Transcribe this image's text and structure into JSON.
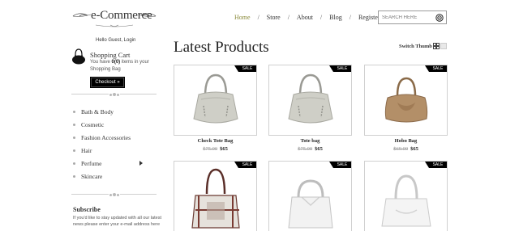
{
  "header": {
    "logo_text": "e-Commerce",
    "nav": [
      {
        "label": "Home"
      },
      {
        "label": "Store"
      },
      {
        "label": "About"
      },
      {
        "label": "Blog"
      },
      {
        "label": "Register"
      }
    ],
    "nav_separator": "/",
    "search": {
      "placeholder": "SEARCH HERE"
    }
  },
  "sidebar": {
    "greeting": "Hello Guest, Login",
    "cart": {
      "title": "Shopping Cart",
      "line1_prefix": "You have ",
      "count": "0(0)",
      "line1_suffix": " items in your",
      "line2": "Shopping Bag",
      "checkout_label": "Checkout »"
    },
    "categories": [
      {
        "label": "Bath & Body"
      },
      {
        "label": "Cosmetic"
      },
      {
        "label": "Fashion Accessories"
      },
      {
        "label": "Hair"
      },
      {
        "label": "Perfume"
      },
      {
        "label": "Skincare"
      }
    ],
    "subscribe": {
      "title": "Subscribe",
      "text": "If you'd like to stay updated with all our latest news please enter your e-mail address here"
    }
  },
  "main": {
    "heading": "Latest Products",
    "switch_label": "Switch Thumb",
    "badge_label": "SALE",
    "products": [
      {
        "name": "Check Tote Bag",
        "old_price": "$75.00",
        "price": "$65"
      },
      {
        "name": "Tote bag",
        "old_price": "$75.00",
        "price": "$65"
      },
      {
        "name": "Hobo Bag",
        "old_price": "$69.00",
        "price": "$65"
      },
      {
        "name": "",
        "old_price": "",
        "price": ""
      },
      {
        "name": "",
        "old_price": "",
        "price": ""
      },
      {
        "name": "",
        "old_price": "",
        "price": ""
      }
    ]
  },
  "colors": {
    "nav_active": "#8a8a3a",
    "badge_bg": "#000000",
    "checkout_bg": "#000000"
  },
  "icons": [
    "logo-swirl-ornament",
    "search-icon",
    "shopping-bag-icon",
    "grid-view-icon",
    "list-view-icon",
    "chevron-right-icon"
  ]
}
